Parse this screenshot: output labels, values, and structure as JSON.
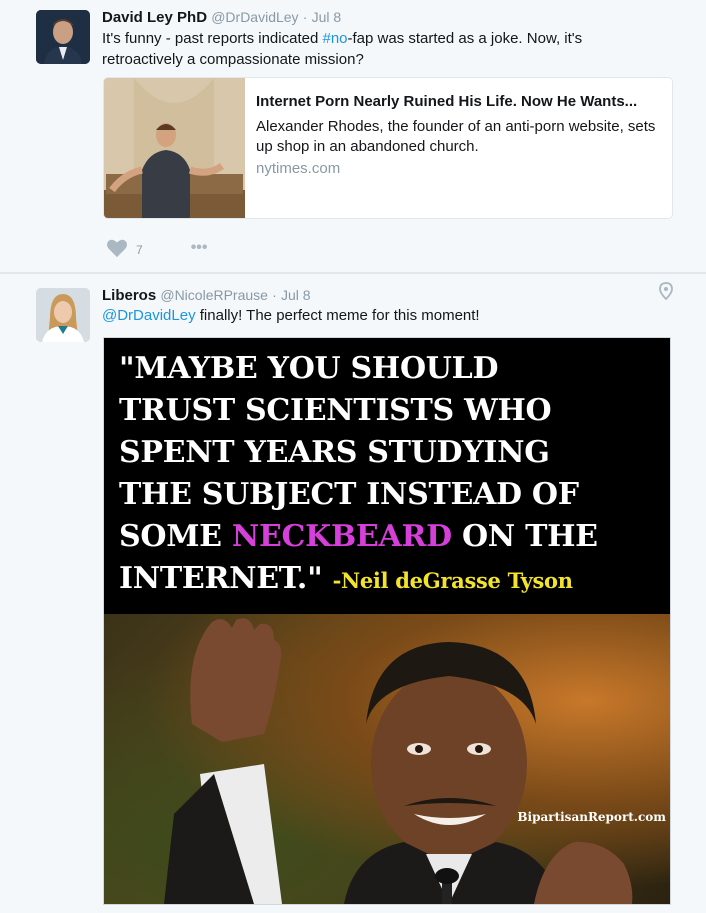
{
  "tweets": [
    {
      "name": "David Ley PhD",
      "handle": "@DrDavidLey",
      "dot": "·",
      "date": "Jul 8",
      "text_before": "It's funny - past reports indicated ",
      "hashtag": "#no",
      "text_after": "-fap was started as a joke. Now, it's retroactively a compassionate mission?",
      "card": {
        "title": "Internet Porn Nearly Ruined His Life. Now He Wants...",
        "description": "Alexander Rhodes, the founder of an anti-porn website, sets up shop in an abandoned church.",
        "domain": "nytimes.com"
      },
      "likes": "7",
      "more_glyph": "•••"
    },
    {
      "name": "Liberos",
      "handle": "@NicoleRPrause",
      "dot": "·",
      "date": "Jul 8",
      "mention": "@DrDavidLey",
      "text_after": " finally! The perfect meme for this moment!",
      "meme": {
        "line1": "\"MAYBE YOU SHOULD",
        "line2": "TRUST SCIENTISTS WHO",
        "line3": "SPENT YEARS STUDYING",
        "line4": "THE SUBJECT INSTEAD OF",
        "line5_before": "SOME ",
        "line5_highlight": "NECKBEARD",
        "line5_after": " ON THE",
        "line6": "INTERNET.\"",
        "attribution": "-Neil deGrasse Tyson",
        "watermark": "BipartisanReport.com"
      }
    }
  ],
  "colors": {
    "link": "#1b95e0",
    "highlight": "#d63fd9",
    "attribution": "#f2e42b",
    "background": "#f5f8fa"
  },
  "icons": [
    "heart-icon",
    "more-options-icon",
    "location-pin-icon"
  ]
}
